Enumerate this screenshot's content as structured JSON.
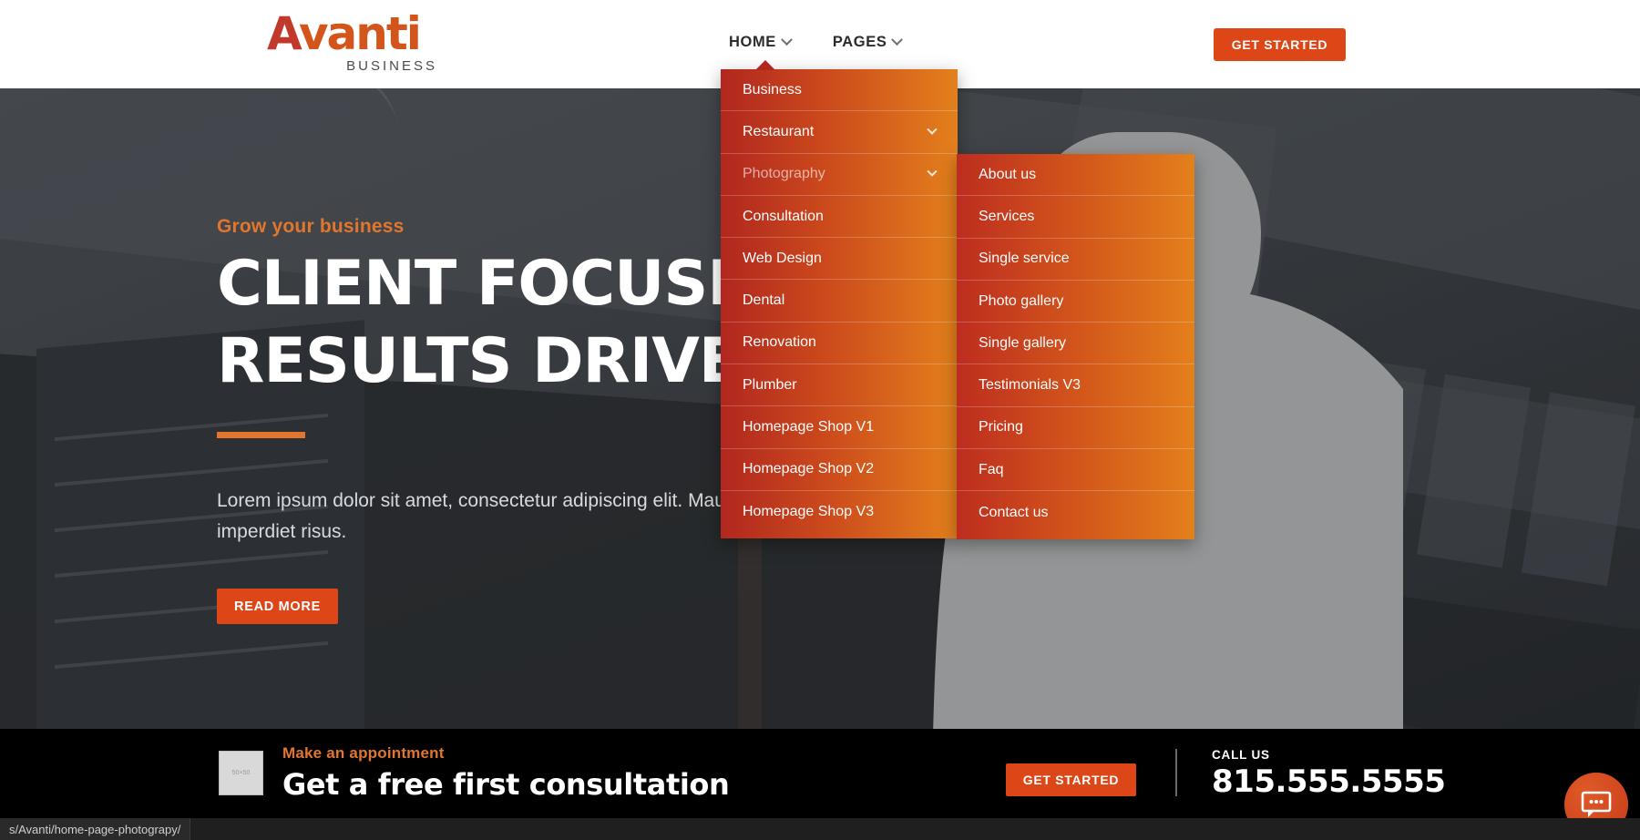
{
  "header": {
    "logo": {
      "word_accent": "A",
      "word_rest": "vanti",
      "subtitle": "BUSINESS"
    },
    "nav": [
      {
        "label": "HOME",
        "has_caret": true
      },
      {
        "label": "PAGES",
        "has_caret": true
      }
    ],
    "cta_button": "GET STARTED"
  },
  "dropdown_home": {
    "items": [
      {
        "label": "Business",
        "submenu": false,
        "dimmed": false
      },
      {
        "label": "Restaurant",
        "submenu": true,
        "dimmed": false
      },
      {
        "label": "Photography",
        "submenu": true,
        "dimmed": true
      },
      {
        "label": "Consultation",
        "submenu": false,
        "dimmed": false
      },
      {
        "label": "Web Design",
        "submenu": false,
        "dimmed": false
      },
      {
        "label": "Dental",
        "submenu": false,
        "dimmed": false
      },
      {
        "label": "Renovation",
        "submenu": false,
        "dimmed": false
      },
      {
        "label": "Plumber",
        "submenu": false,
        "dimmed": false
      },
      {
        "label": "Homepage Shop V1",
        "submenu": false,
        "dimmed": false
      },
      {
        "label": "Homepage Shop V2",
        "submenu": false,
        "dimmed": false
      },
      {
        "label": "Homepage Shop V3",
        "submenu": false,
        "dimmed": false
      }
    ]
  },
  "dropdown_photography": {
    "items": [
      {
        "label": "About us"
      },
      {
        "label": "Services"
      },
      {
        "label": "Single service"
      },
      {
        "label": "Photo gallery"
      },
      {
        "label": "Single gallery"
      },
      {
        "label": "Testimonials V3"
      },
      {
        "label": "Pricing"
      },
      {
        "label": "Faq"
      },
      {
        "label": "Contact us"
      }
    ]
  },
  "hero": {
    "eyebrow": "Grow your business",
    "title_line1": "CLIENT FOCUSED",
    "title_line2": "RESULTS DRIVEN",
    "paragraph": "Lorem ipsum dolor sit amet, consectetur adipiscing elit. Mauris imperdiet risus.",
    "button": "READ MORE"
  },
  "cta_bar": {
    "thumb_label": "50×50",
    "small_text": "Make an appointment",
    "big_text": "Get a free first consultation",
    "button": "GET STARTED",
    "call_label": "CALL US",
    "phone": "815.555.5555"
  },
  "chat_widget": {
    "icon": "chat-bubble-icon"
  },
  "status_bar": {
    "url": "s/Avanti/home-page-photograpy/"
  },
  "colors": {
    "accent_orange": "#dd4718",
    "eyebrow_orange": "#e2762c",
    "menu_gradient_start": "#b1271f",
    "menu_gradient_end": "#e3801c",
    "logo_red": "#c0392b",
    "logo_orange": "#d3551c",
    "bar_black": "#000000"
  }
}
